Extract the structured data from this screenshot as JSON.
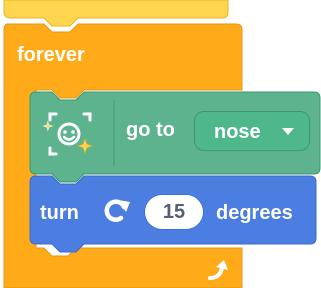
{
  "forever_block": {
    "label": "forever",
    "color": "#ffab19",
    "border_color": "#e6971a"
  },
  "goto_block": {
    "icon": "face-sensing-icon",
    "label": "go to",
    "dropdown_value": "nose",
    "color": "#5cb38d",
    "border_color": "#3a9a6f"
  },
  "turn_block": {
    "label": "turn",
    "direction_icon": "rotate-right-icon",
    "degrees_value": "15",
    "unit_label": "degrees",
    "color": "#4c7de0",
    "border_color": "#3d6bc7"
  },
  "loop_icon": "loop-arrow-icon",
  "hat_color": "#ffd54f"
}
